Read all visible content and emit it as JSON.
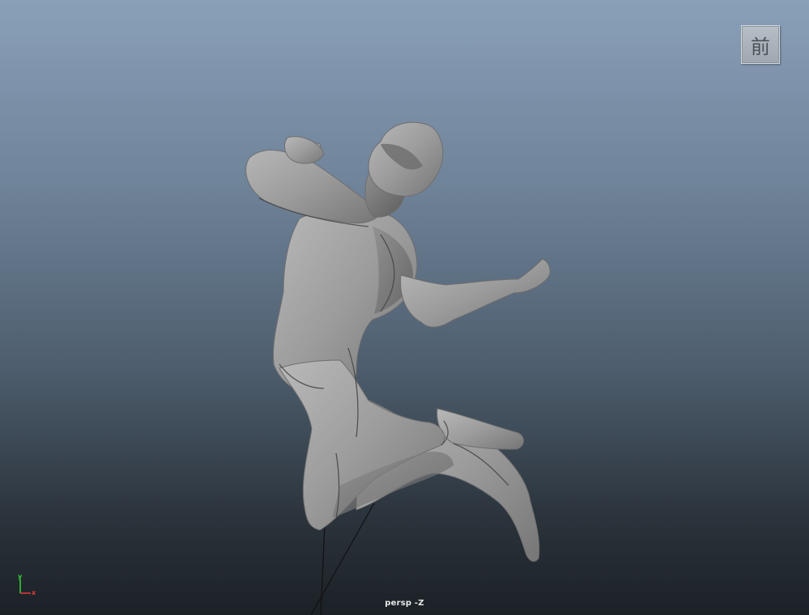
{
  "viewport": {
    "camera_label": "persp -Z"
  },
  "viewcube": {
    "face_label": "前"
  },
  "axis_gizmo": {
    "y_label": "y",
    "x_label": "x",
    "y_color": "#33d633",
    "x_color": "#e23b3b"
  },
  "model": {
    "icon": "humanoid-figure-jumping",
    "shade_color": "#9a9a9a"
  }
}
